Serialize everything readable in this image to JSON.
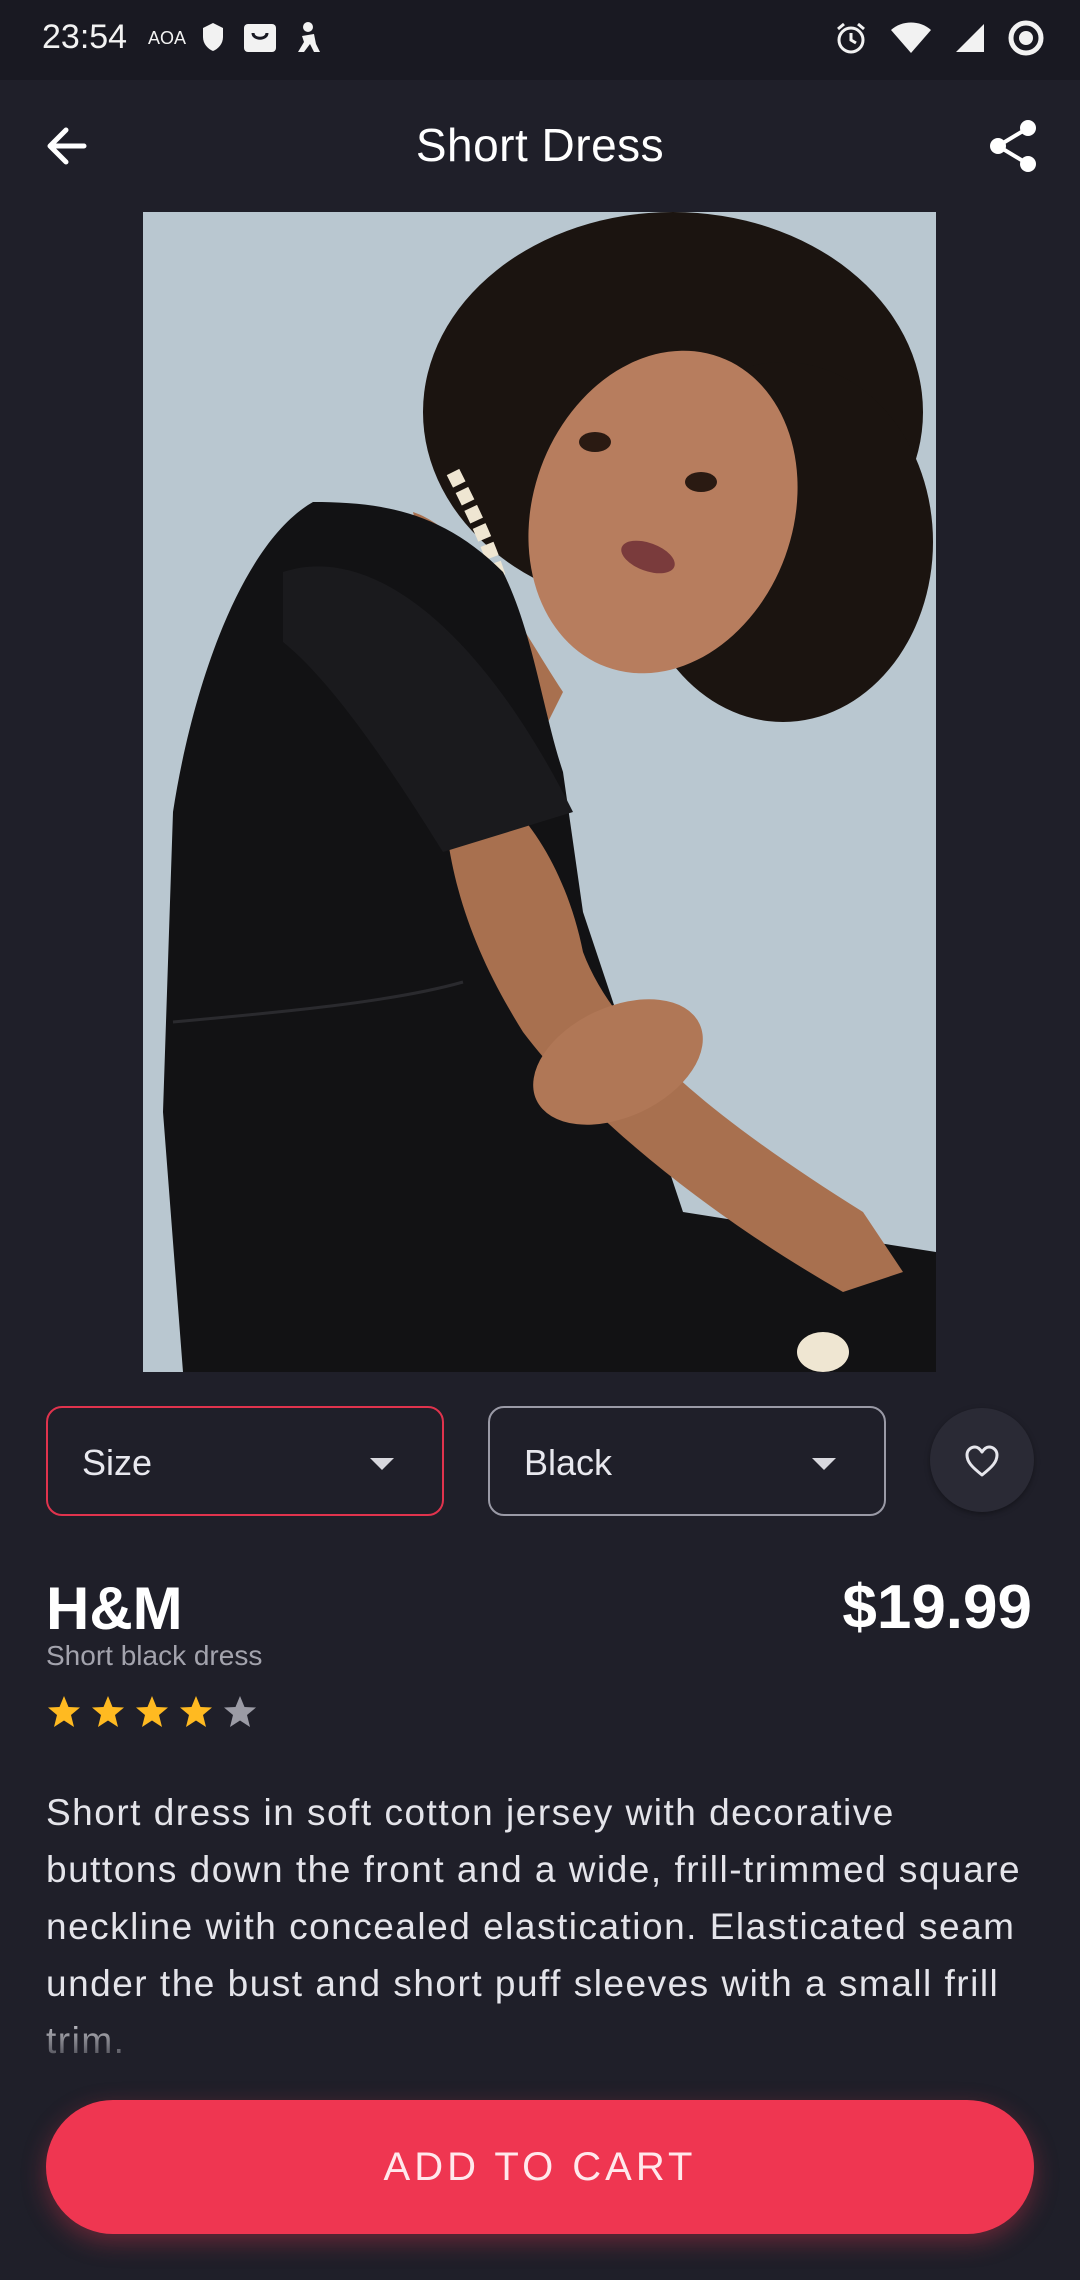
{
  "status_bar": {
    "time": "23:54",
    "carrier": "AOA",
    "notification_icons": [
      "shield-icon",
      "bag-icon",
      "figure-icon"
    ],
    "right_icons": [
      "alarm-icon",
      "wifi-icon",
      "signal-icon",
      "record-icon"
    ]
  },
  "app_bar": {
    "title": "Short Dress",
    "back_icon": "arrow-left-icon",
    "share_icon": "share-icon"
  },
  "product": {
    "image_alt": "Woman wearing a short black dress",
    "size_select": {
      "value": "Size"
    },
    "color_select": {
      "value": "Black"
    },
    "brand": "H&M",
    "price": "$19.99",
    "subtitle": "Short black dress",
    "rating": {
      "value": 4,
      "max": 5
    },
    "description": "Short dress in soft cotton jersey with decorative buttons down the front and a wide, frill-trimmed square neckline with concealed elastication. Elasticated seam under the bust and short puff sleeves with a small frill trim."
  },
  "actions": {
    "add_to_cart": "ADD TO CART"
  },
  "colors": {
    "background": "#1f1f29",
    "accent": "#ef3651",
    "star_active": "#ffba21",
    "star_inactive": "#9b9ba5"
  }
}
